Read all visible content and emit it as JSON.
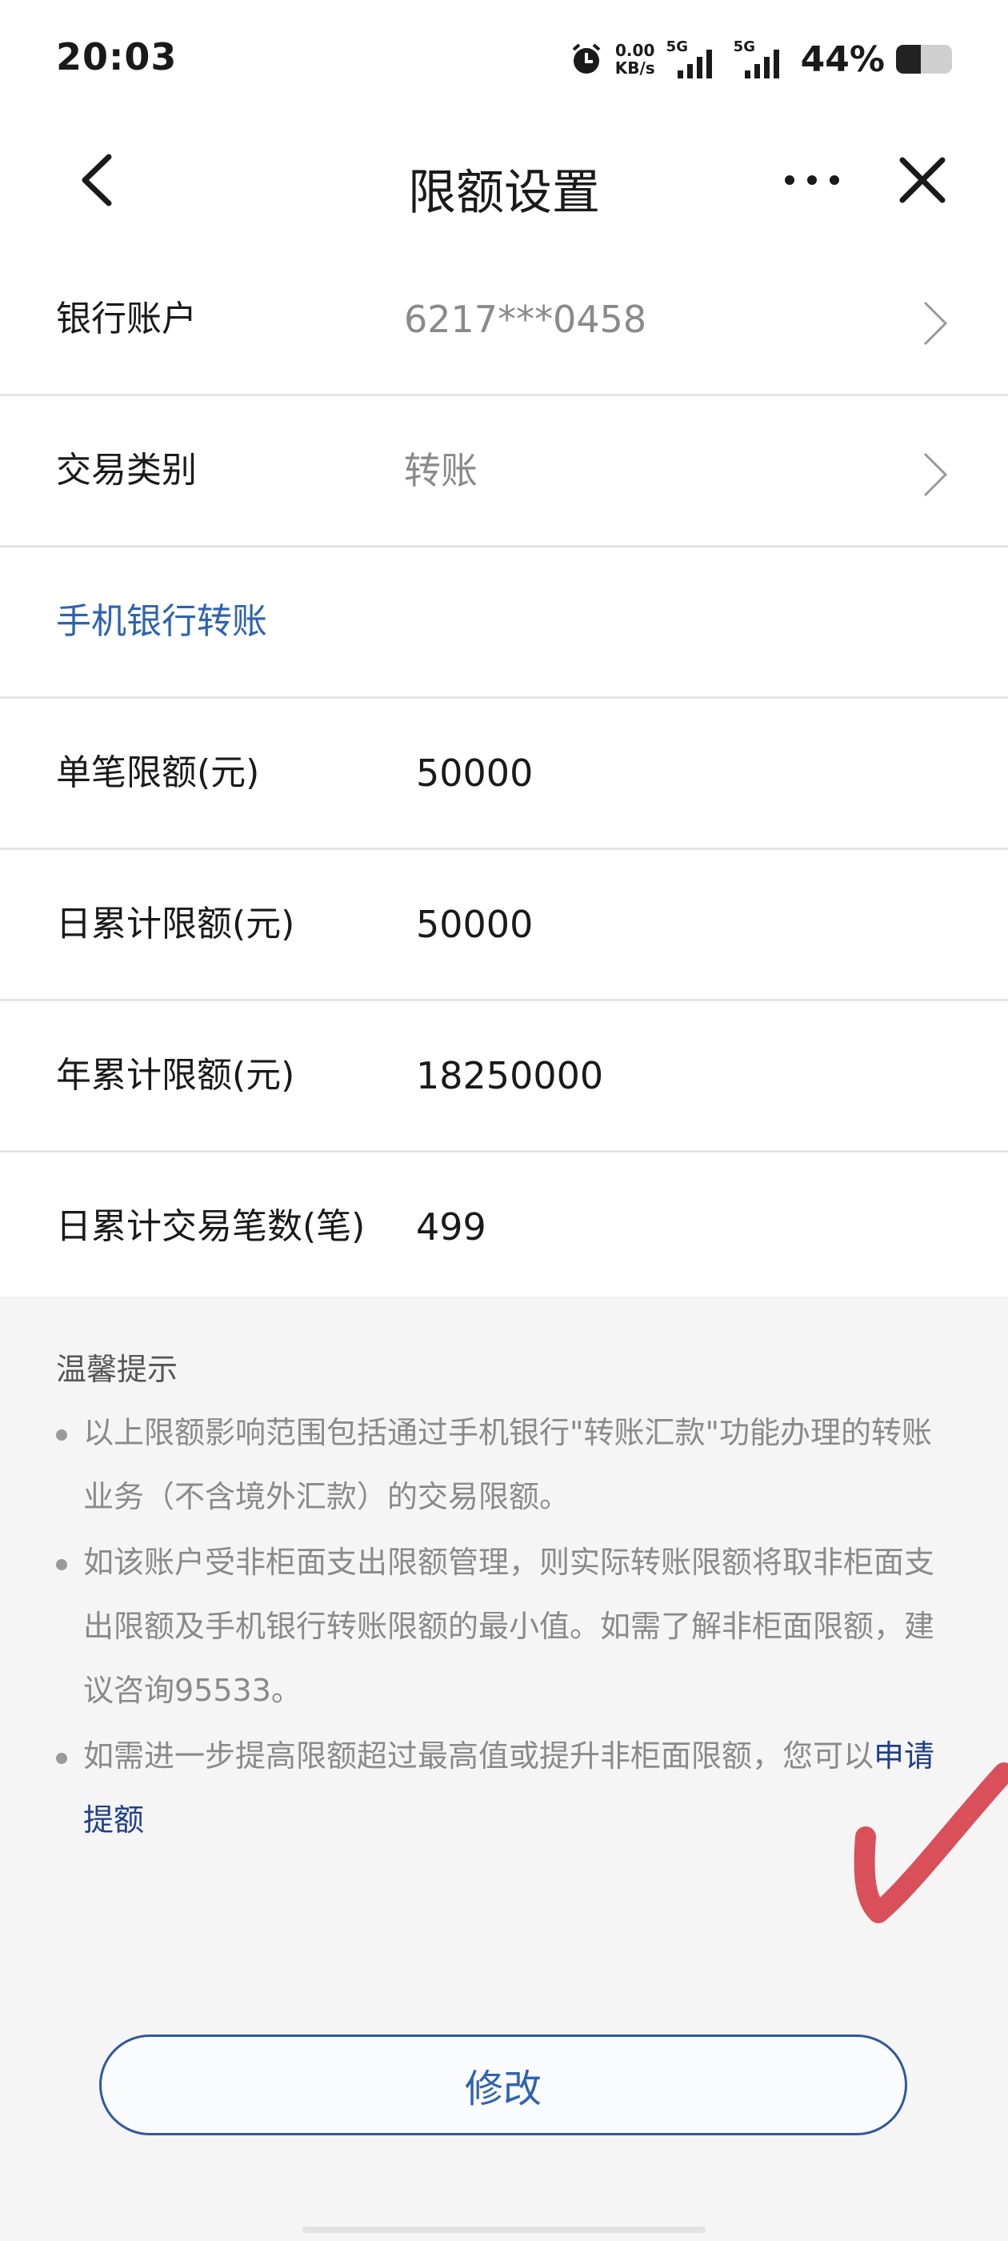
{
  "status_bar": {
    "time": "20:03",
    "net_speed_value": "0.00",
    "net_speed_unit": "KB/s",
    "signal_1_label": "5G",
    "signal_2_label": "5G",
    "battery_percent": "44%",
    "battery_level": 0.44
  },
  "nav": {
    "title": "限额设置",
    "back_icon": "chevron-left-icon",
    "more_icon": "more-dots-icon",
    "close_icon": "close-icon"
  },
  "account_row": {
    "label": "银行账户",
    "value": "6217***0458"
  },
  "type_row": {
    "label": "交易类别",
    "value": "转账"
  },
  "section": {
    "label": "手机银行转账"
  },
  "limits": [
    {
      "label": "单笔限额(元)",
      "value": "50000"
    },
    {
      "label": "日累计限额(元)",
      "value": "50000"
    },
    {
      "label": "年累计限额(元)",
      "value": "18250000"
    },
    {
      "label": "日累计交易笔数(笔)",
      "value": "499"
    }
  ],
  "tips": {
    "title": "温馨提示",
    "items": [
      "以上限额影响范围包括通过手机银行\"转账汇款\"功能办理的转账业务（不含境外汇款）的交易限额。",
      "如该账户受非柜面支出限额管理，则实际转账限额将取非柜面支出限额及手机银行转账限额的最小值。如需了解非柜面限额，建议咨询95533。",
      "如需进一步提高限额超过最高值或提升非柜面限额，您可以"
    ],
    "link_text": "申请提额"
  },
  "modify_button": "修改",
  "colors": {
    "accent": "#2e63b0",
    "link": "#1f3f8a",
    "check_mark": "#d9505a"
  }
}
